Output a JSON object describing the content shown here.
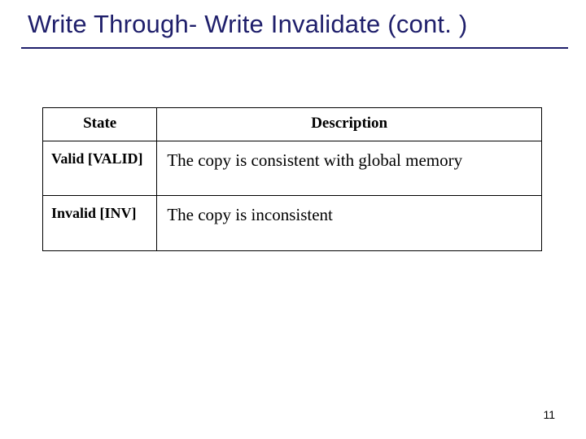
{
  "title": "Write Through- Write Invalidate (cont. )",
  "table": {
    "headers": {
      "state": "State",
      "description": "Description"
    },
    "rows": [
      {
        "state": "Valid [VALID]",
        "description": "The copy is consistent with global memory"
      },
      {
        "state": "Invalid [INV]",
        "description": "The copy is inconsistent"
      }
    ]
  },
  "page_number": "11"
}
